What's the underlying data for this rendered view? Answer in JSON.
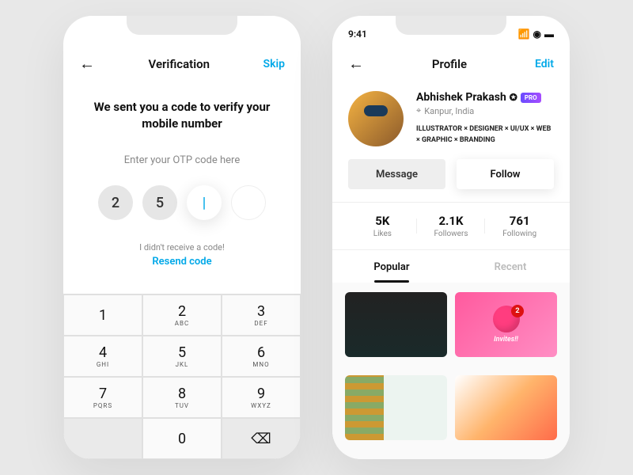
{
  "accent": "#00A8E8",
  "verification": {
    "header": {
      "title": "Verification",
      "action": "Skip"
    },
    "heading": "We sent you a code to verify your mobile number",
    "placeholder": "Enter your OTP code here",
    "otp": [
      "2",
      "5",
      "|",
      ""
    ],
    "no_code": "I didn't receive a code!",
    "resend": "Resend code",
    "keypad": [
      {
        "digit": "1",
        "letters": ""
      },
      {
        "digit": "2",
        "letters": "ABC"
      },
      {
        "digit": "3",
        "letters": "DEF"
      },
      {
        "digit": "4",
        "letters": "GHI"
      },
      {
        "digit": "5",
        "letters": "JKL"
      },
      {
        "digit": "6",
        "letters": "MNO"
      },
      {
        "digit": "7",
        "letters": "PQRS"
      },
      {
        "digit": "8",
        "letters": "TUV"
      },
      {
        "digit": "9",
        "letters": "WXYZ"
      },
      {
        "digit": "",
        "letters": ""
      },
      {
        "digit": "0",
        "letters": ""
      },
      {
        "digit": "⌫",
        "letters": ""
      }
    ]
  },
  "profile": {
    "status_time": "9:41",
    "header": {
      "title": "Profile",
      "action": "Edit"
    },
    "name": "Abhishek Prakash",
    "pro_label": "PRO",
    "location": "Kanpur, India",
    "tags": "ILLUSTRATOR × DESIGNER × UI/UX × WEB × GRAPHIC × BRANDING",
    "message_btn": "Message",
    "follow_btn": "Follow",
    "stats": [
      {
        "value": "5K",
        "label": "Likes"
      },
      {
        "value": "2.1K",
        "label": "Followers"
      },
      {
        "value": "761",
        "label": "Following"
      }
    ],
    "tabs": {
      "popular": "Popular",
      "recent": "Recent"
    },
    "invites_text": "Invites!!",
    "invites_count": "2"
  }
}
